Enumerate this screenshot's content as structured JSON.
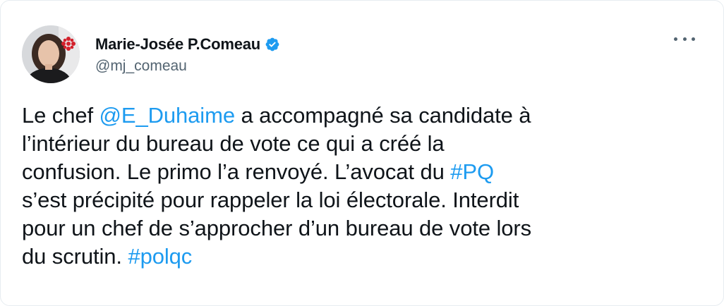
{
  "tweet": {
    "author": {
      "display_name": "Marie-Josée P.Comeau",
      "handle": "@mj_comeau",
      "verified": true
    },
    "lines": [
      [
        {
          "text": "Le chef ",
          "type": "text"
        },
        {
          "text": "@E_Duhaime",
          "type": "mention"
        },
        {
          "text": " a accompagné sa candidate à",
          "type": "text"
        }
      ],
      [
        {
          "text": "l’intérieur du bureau de vote ce qui a créé la",
          "type": "text"
        }
      ],
      [
        {
          "text": "confusion. Le primo l’a renvoyé. L’avocat du ",
          "type": "text"
        },
        {
          "text": "#PQ",
          "type": "hashtag"
        }
      ],
      [
        {
          "text": "s’est précipité pour rappeler la loi électorale. Interdit",
          "type": "text"
        }
      ],
      [
        {
          "text": "pour un chef de s’approcher d’un bureau de vote lors",
          "type": "text"
        }
      ],
      [
        {
          "text": "du scrutin. ",
          "type": "text"
        },
        {
          "text": "#polqc",
          "type": "hashtag"
        }
      ]
    ]
  },
  "colors": {
    "link": "#1d9bf0",
    "text": "#0f1419",
    "secondary": "#536471",
    "verified": "#1d9bf0"
  },
  "icons": {
    "verified": "verified-badge-icon",
    "more": "more-options-icon"
  }
}
